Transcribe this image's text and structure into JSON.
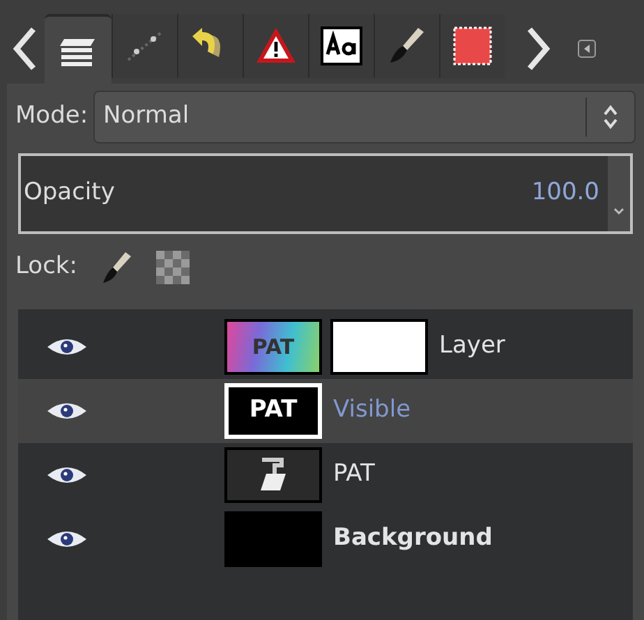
{
  "tabs": [
    {
      "kind": "layers",
      "selected": true
    },
    {
      "kind": "paths",
      "selected": false
    },
    {
      "kind": "undo",
      "selected": false
    },
    {
      "kind": "warning",
      "selected": false
    },
    {
      "kind": "font",
      "selected": false
    },
    {
      "kind": "brush",
      "selected": false
    },
    {
      "kind": "pattern",
      "selected": false
    }
  ],
  "mode": {
    "label": "Mode:",
    "value": "Normal"
  },
  "opacity": {
    "label": "Opacity",
    "value": "100.0"
  },
  "lock": {
    "label": "Lock:"
  },
  "layers": [
    {
      "name": "Layer",
      "selected": false,
      "bold": false,
      "kind": "gradient",
      "thumb_text": "PAT",
      "mask": true
    },
    {
      "name": "Visible",
      "selected": true,
      "bold": false,
      "kind": "black-text",
      "thumb_text": "PAT",
      "mask": false
    },
    {
      "name": "PAT",
      "selected": false,
      "bold": false,
      "kind": "text-layer",
      "mask": false
    },
    {
      "name": "Background",
      "selected": false,
      "bold": true,
      "kind": "black",
      "mask": false
    }
  ]
}
